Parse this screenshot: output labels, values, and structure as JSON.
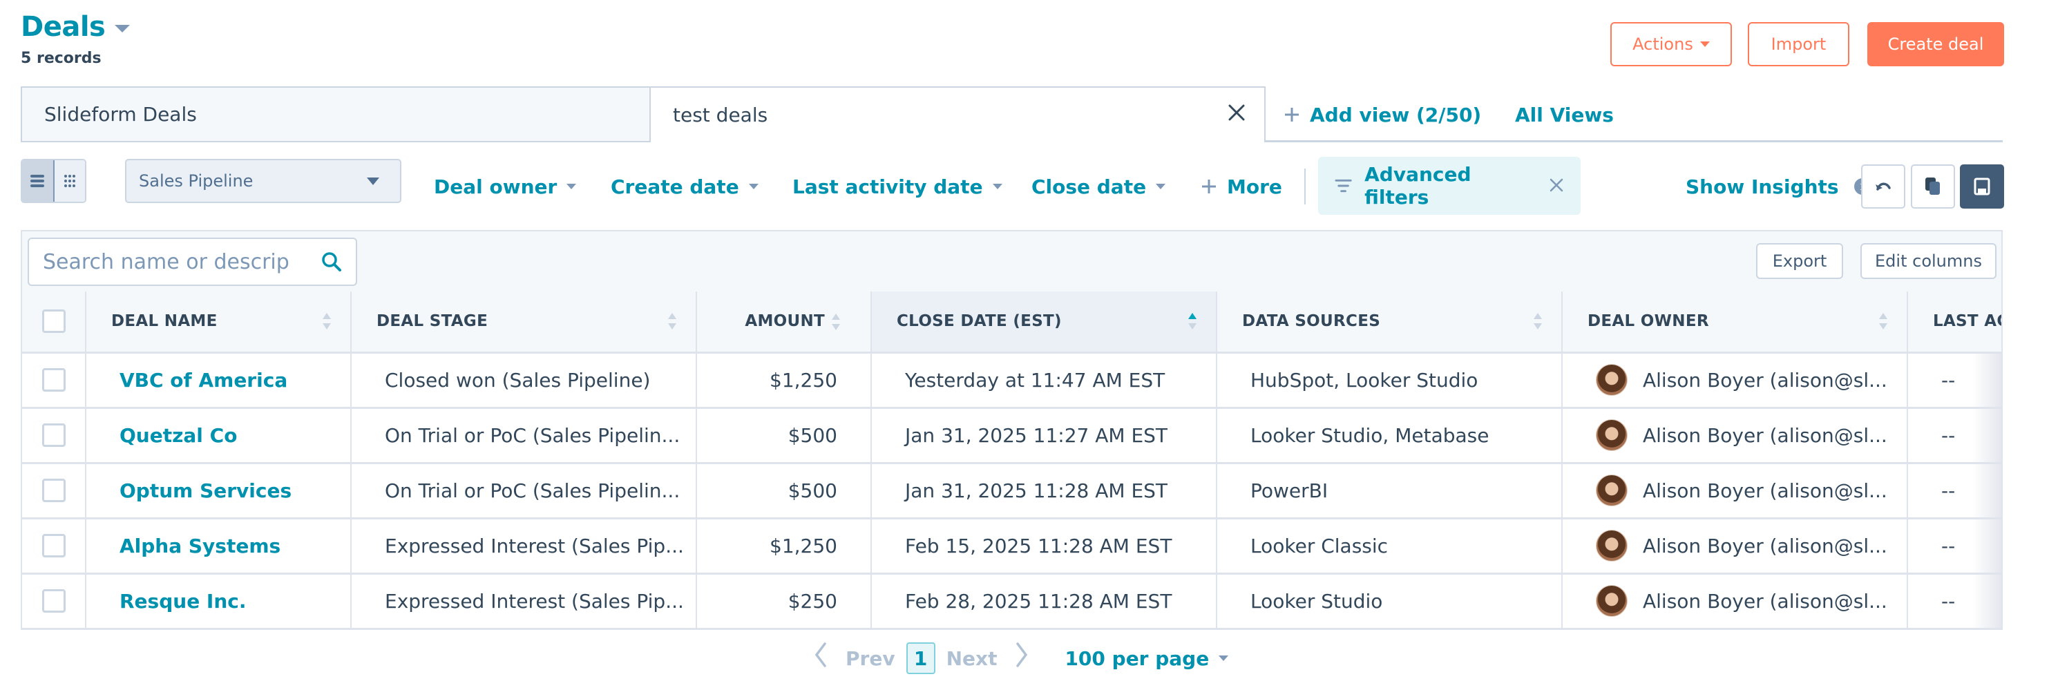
{
  "header": {
    "title": "Deals",
    "record_count": "5 records",
    "actions_label": "Actions",
    "import_label": "Import",
    "create_label": "Create deal"
  },
  "views": {
    "tabs": [
      {
        "label": "Slideform Deals",
        "active": false
      },
      {
        "label": "test deals",
        "active": true
      }
    ],
    "add_view_label": "Add view (2/50)",
    "all_views_label": "All Views"
  },
  "toolbar": {
    "pipeline": "Sales Pipeline",
    "filters": [
      "Deal owner",
      "Create date",
      "Last activity date",
      "Close date"
    ],
    "more_label": "More",
    "advanced_filters_label": "Advanced filters",
    "show_insights_label": "Show Insights",
    "icons": [
      "undo-icon",
      "clone-icon",
      "save-icon"
    ]
  },
  "table_tools": {
    "search_placeholder": "Search name or descrip",
    "export_label": "Export",
    "edit_columns_label": "Edit columns"
  },
  "table": {
    "columns": [
      "DEAL NAME",
      "DEAL STAGE",
      "AMOUNT",
      "CLOSE DATE (EST)",
      "DATA SOURCES",
      "DEAL OWNER",
      "LAST AC"
    ],
    "sorted_column": "CLOSE DATE (EST)",
    "sort_direction": "ascending",
    "rows": [
      {
        "name": "VBC of America",
        "stage": "Closed won (Sales Pipeline)",
        "amount": "$1,250",
        "close_date": "Yesterday at 11:47 AM EST",
        "sources": "HubSpot, Looker Studio",
        "owner": "Alison Boyer (alison@sl...",
        "last_activity": "--"
      },
      {
        "name": "Quetzal Co",
        "stage": "On Trial or PoC (Sales Pipelin...",
        "amount": "$500",
        "close_date": "Jan 31, 2025 11:27 AM EST",
        "sources": "Looker Studio, Metabase",
        "owner": "Alison Boyer (alison@sl...",
        "last_activity": "--"
      },
      {
        "name": "Optum Services",
        "stage": "On Trial or PoC (Sales Pipelin...",
        "amount": "$500",
        "close_date": "Jan 31, 2025 11:28 AM EST",
        "sources": "PowerBI",
        "owner": "Alison Boyer (alison@sl...",
        "last_activity": "--"
      },
      {
        "name": "Alpha Systems",
        "stage": "Expressed Interest (Sales Pip...",
        "amount": "$1,250",
        "close_date": "Feb 15, 2025 11:28 AM EST",
        "sources": "Looker Classic",
        "owner": "Alison Boyer (alison@sl...",
        "last_activity": "--"
      },
      {
        "name": "Resque Inc.",
        "stage": "Expressed Interest (Sales Pip...",
        "amount": "$250",
        "close_date": "Feb 28, 2025 11:28 AM EST",
        "sources": "Looker Studio",
        "owner": "Alison Boyer (alison@sl...",
        "last_activity": "--"
      }
    ]
  },
  "pagination": {
    "prev_label": "Prev",
    "current_page": "1",
    "next_label": "Next",
    "per_page_label": "100 per page"
  },
  "colors": {
    "brand_teal": "#0091ae",
    "accent_orange": "#ff7a59",
    "text_dark": "#33475b",
    "muted": "#7c98b6",
    "save_button": "#425b76"
  }
}
